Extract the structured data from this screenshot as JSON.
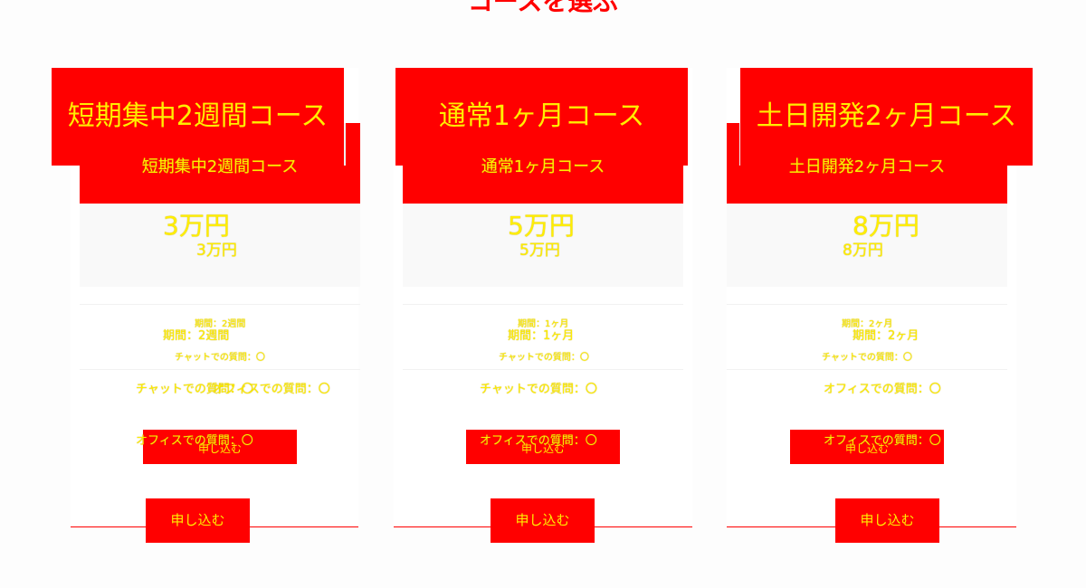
{
  "page": {
    "title": "コースを選ぶ",
    "subtitle": ""
  },
  "colors": {
    "accent": "#ff0000",
    "text_on_accent": "#ffee00",
    "strip": "#efefef"
  },
  "courses": [
    {
      "name": "短期集中2週間コース",
      "price": "3万円",
      "period": "期間：2週間",
      "chat": "チャットでの質問：〇",
      "office": "オフィスでの質問：〇",
      "mini_button": "申し込む",
      "apply": "申し込む"
    },
    {
      "name": "通常1ヶ月コース",
      "price": "5万円",
      "period": "期間：1ヶ月",
      "chat": "チャットでの質問：〇",
      "office": "オフィスでの質問：〇",
      "mini_button": "申し込む",
      "apply": "申し込む"
    },
    {
      "name": "土日開発2ヶ月コース",
      "price": "8万円",
      "period": "期間：2ヶ月",
      "chat": "チャットでの質問：〇",
      "office": "オフィスでの質問：〇",
      "mini_button": "申し込む",
      "apply": "申し込む"
    }
  ]
}
